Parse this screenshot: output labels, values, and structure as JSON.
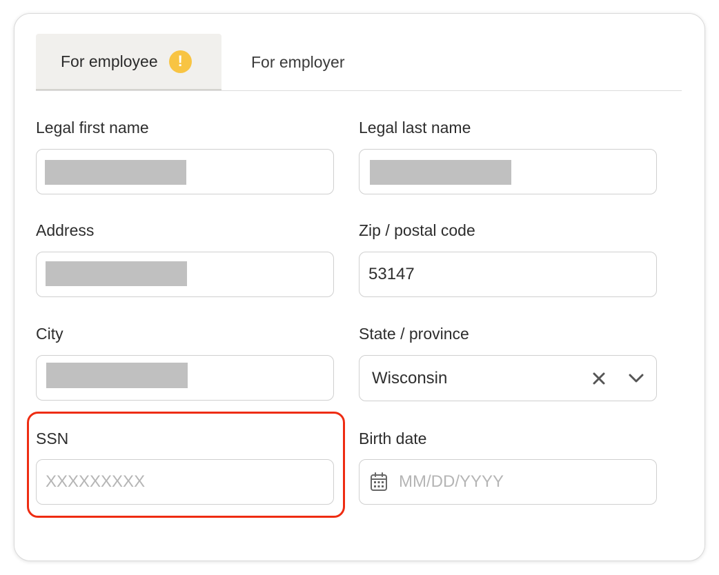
{
  "tabs": [
    {
      "label": "For employee",
      "active": true,
      "badge_icon": "warning-icon",
      "badge_symbol": "!"
    },
    {
      "label": "For employer",
      "active": false
    }
  ],
  "form": {
    "first_name": {
      "label": "Legal first name",
      "value_redacted": true
    },
    "last_name": {
      "label": "Legal last name",
      "value_redacted": true
    },
    "address": {
      "label": "Address",
      "value_redacted": true
    },
    "zip": {
      "label": "Zip / postal code",
      "value": "53147"
    },
    "city": {
      "label": "City",
      "value_redacted": true
    },
    "state": {
      "label": "State / province",
      "value": "Wisconsin",
      "clear_icon": "close-icon",
      "dropdown_icon": "chevron-down-icon"
    },
    "ssn": {
      "label": "SSN",
      "placeholder": "XXXXXXXXX",
      "highlighted": true
    },
    "birth_date": {
      "label": "Birth date",
      "placeholder": "MM/DD/YYYY",
      "icon": "calendar-icon"
    }
  },
  "colors": {
    "warning": "#f8c443",
    "highlight": "#ee2c12",
    "active_tab_bg": "#f1f0ed",
    "redaction": "#c0c0c0"
  }
}
